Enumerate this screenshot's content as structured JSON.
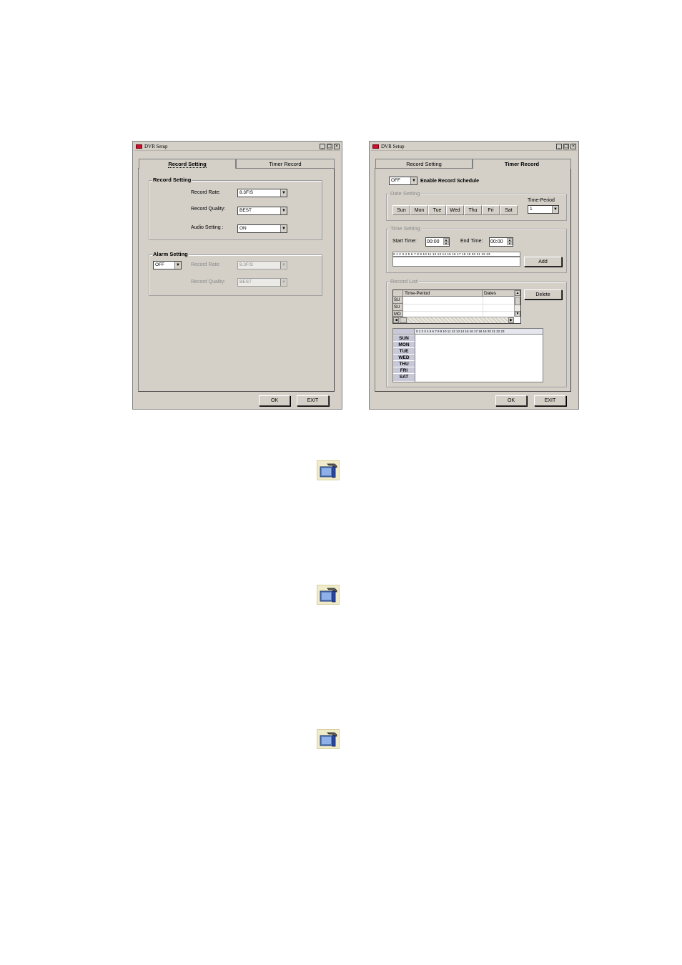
{
  "left_window": {
    "title": "DVR Setup",
    "tabs": [
      "Record Setting",
      "Timer Record"
    ],
    "record_setting": {
      "group_title": "Record Setting",
      "rate_label": "Record Rate:",
      "rate_value": "8.3F/S",
      "quality_label": "Record Quality:",
      "quality_value": "BEST",
      "audio_label": "Audio Setting :",
      "audio_value": "ON"
    },
    "alarm_setting": {
      "group_title": "Alarm Setting",
      "mode_value": "OFF",
      "rate_label": "Record Rate:",
      "rate_value": "8.3F/S",
      "quality_label": "Record Quality:",
      "quality_value": "BEST"
    },
    "ok_label": "OK",
    "exit_label": "EXIT"
  },
  "right_window": {
    "title": "DVR Setup",
    "tabs": [
      "Record Setting",
      "Timer Record"
    ],
    "schedule_mode": "OFF",
    "enable_label": "Enable Record Schedule",
    "date_setting": {
      "group_title": "Date Setting",
      "days": [
        "Sun",
        "Mon",
        "Tue",
        "Wed",
        "Thu",
        "Fri",
        "Sat"
      ],
      "period_label": "Time-Period",
      "period_value": "1"
    },
    "time_setting": {
      "group_title": "Time Setting",
      "start_label": "Start Time:",
      "start_value": "00:00",
      "end_label": "End Time:",
      "end_value": "00:00",
      "hours_ruler": "0 1 2 3 4 5 6 7 8 9 10 11 12 13 14 15 16 17 18 19 20 21 22 23",
      "add_label": "Add"
    },
    "record_list": {
      "group_title": "Record List",
      "col_period": "Time-Period",
      "col_dates": "Dates",
      "row_headers": [
        "SU",
        "SU",
        "MO"
      ],
      "delete_label": "Delete",
      "grid_hours": "0 1 2 3 4 5 6 7 8 9 10 11 12 13 14 15 16 17 18 19 20 21 22 23",
      "grid_days": [
        "SUN",
        "MON",
        "TUE",
        "WED",
        "THU",
        "FRI",
        "SAT"
      ]
    },
    "ok_label": "OK",
    "exit_label": "EXIT"
  },
  "icons": [
    "tools-icon",
    "tools-icon",
    "tools-icon"
  ]
}
